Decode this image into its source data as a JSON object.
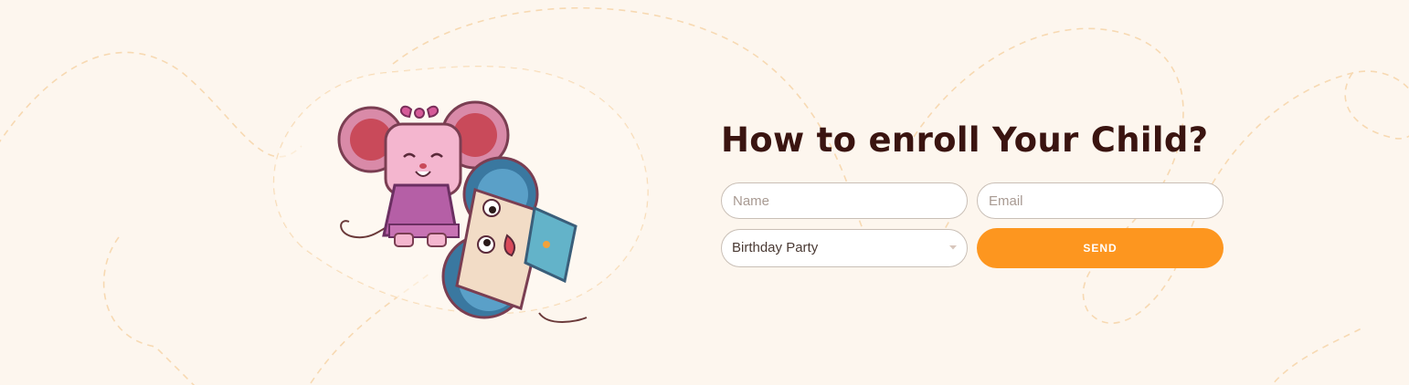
{
  "enroll": {
    "title": "How to enroll Your Child?",
    "name_placeholder": "Name",
    "email_placeholder": "Email",
    "selected_option": "Birthday Party",
    "send_label": "SEND"
  },
  "colors": {
    "background": "#fdf6ee",
    "title": "#3a1410",
    "accent": "#fd961f",
    "dashed_line": "#f7d9b2"
  },
  "icons": [
    "chevron-down-icon"
  ]
}
